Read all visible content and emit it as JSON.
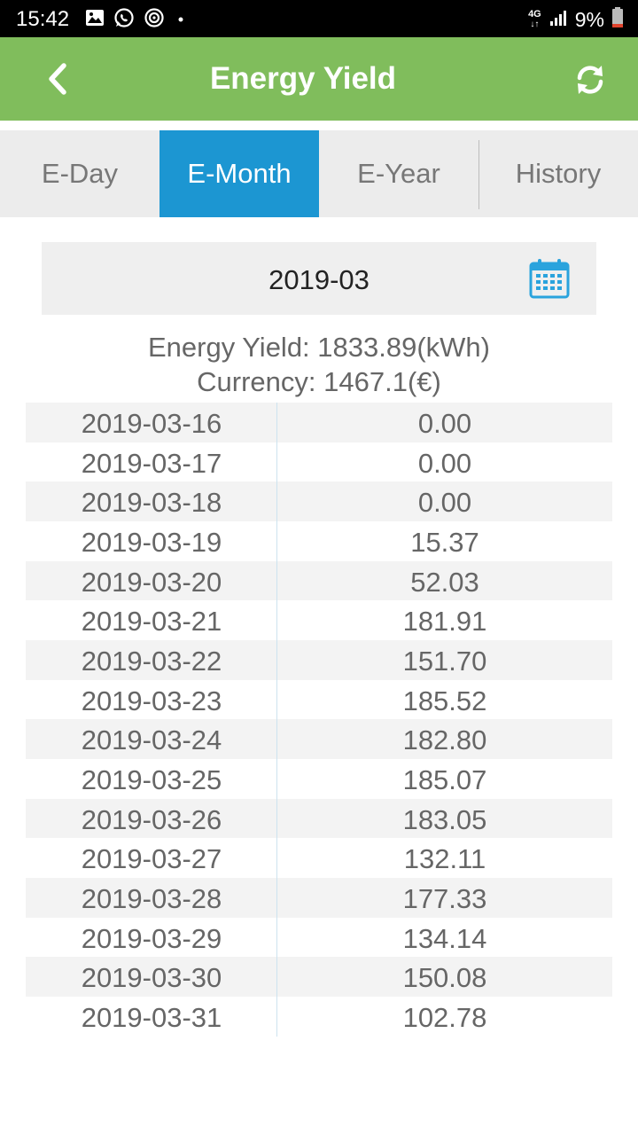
{
  "status_bar": {
    "time": "15:42",
    "network": "4G",
    "battery": "9%",
    "icons": [
      "gallery-icon",
      "whatsapp-icon",
      "sync-app-icon",
      "dot-icon"
    ]
  },
  "app_bar": {
    "title": "Energy Yield",
    "back_icon": "chevron-left-icon",
    "refresh_icon": "refresh-icon"
  },
  "tabs": [
    {
      "label": "E-Day",
      "active": false
    },
    {
      "label": "E-Month",
      "active": true
    },
    {
      "label": "E-Year",
      "active": false
    },
    {
      "label": "History",
      "active": false
    }
  ],
  "date_picker": {
    "value": "2019-03",
    "icon": "calendar-icon"
  },
  "summary": {
    "energy_yield": "Energy Yield: 1833.89(kWh)",
    "currency": "Currency: 1467.1(€)"
  },
  "rows": [
    {
      "date": "2019-03-16",
      "value": "0.00"
    },
    {
      "date": "2019-03-17",
      "value": "0.00"
    },
    {
      "date": "2019-03-18",
      "value": "0.00"
    },
    {
      "date": "2019-03-19",
      "value": "15.37"
    },
    {
      "date": "2019-03-20",
      "value": "52.03"
    },
    {
      "date": "2019-03-21",
      "value": "181.91"
    },
    {
      "date": "2019-03-22",
      "value": "151.70"
    },
    {
      "date": "2019-03-23",
      "value": "185.52"
    },
    {
      "date": "2019-03-24",
      "value": "182.80"
    },
    {
      "date": "2019-03-25",
      "value": "185.07"
    },
    {
      "date": "2019-03-26",
      "value": "183.05"
    },
    {
      "date": "2019-03-27",
      "value": "132.11"
    },
    {
      "date": "2019-03-28",
      "value": "177.33"
    },
    {
      "date": "2019-03-29",
      "value": "134.14"
    },
    {
      "date": "2019-03-30",
      "value": "150.08"
    },
    {
      "date": "2019-03-31",
      "value": "102.78"
    }
  ],
  "colors": {
    "app_bar": "#80bd5c",
    "active_tab": "#1c96d2",
    "calendar_icon": "#2aa3dd"
  }
}
